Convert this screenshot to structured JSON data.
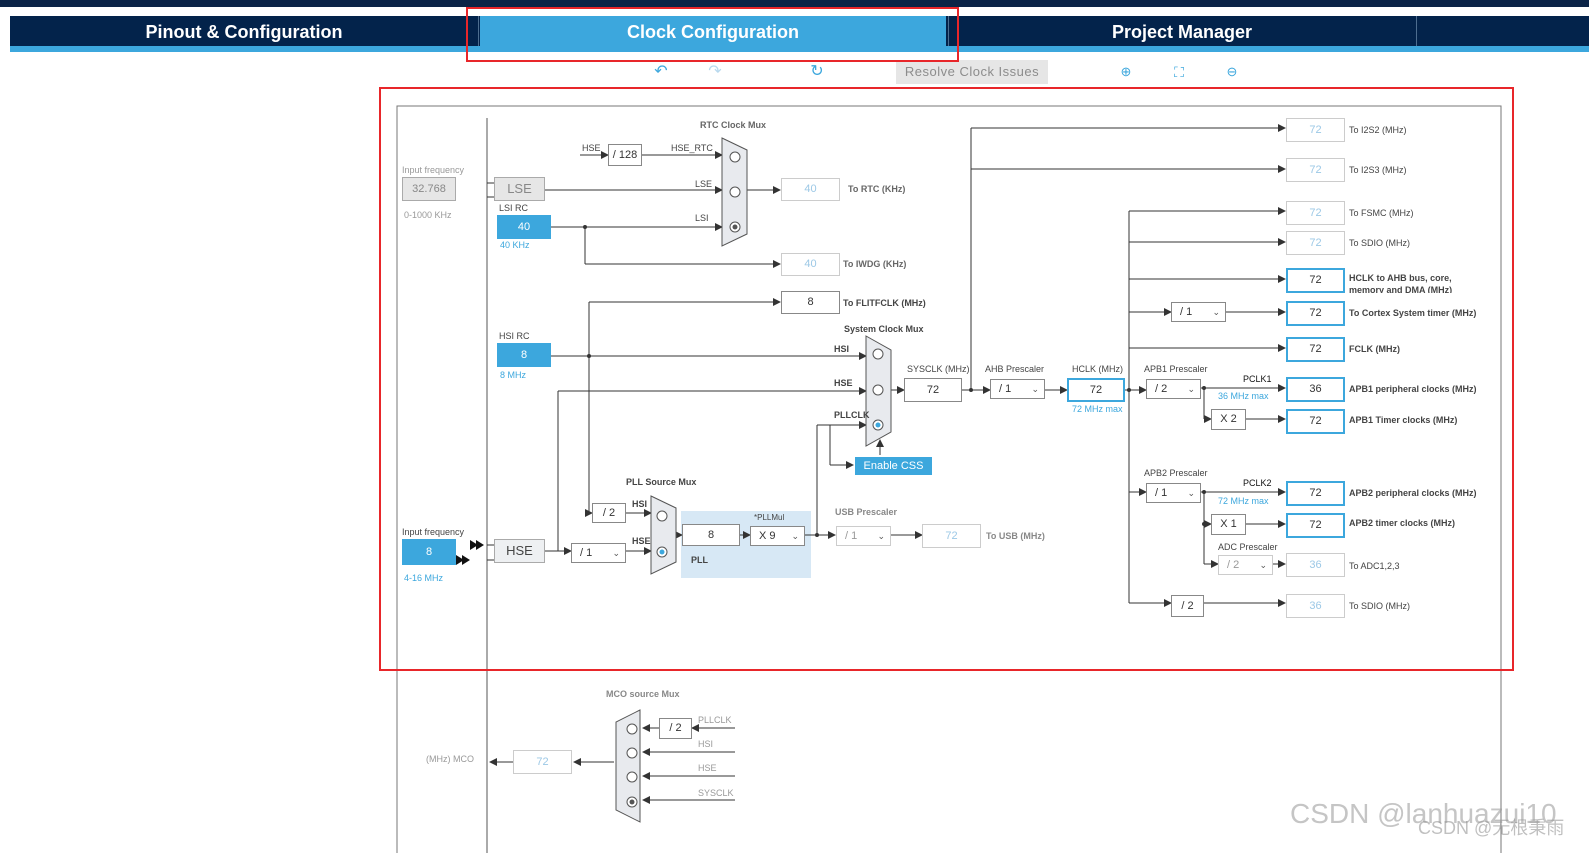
{
  "tabs": {
    "pinout": "Pinout & Configuration",
    "clock": "Clock Configuration",
    "project": "Project Manager"
  },
  "toolbar": {
    "resolve": "Resolve Clock Issues",
    "undo_icon": "undo-icon",
    "redo_icon": "redo-icon",
    "reset_icon": "reset-icon",
    "zoom_in_icon": "zoom-in-icon",
    "fit_icon": "fit-icon",
    "zoom_out_icon": "zoom-out-icon"
  },
  "colors": {
    "accent": "#3ca7dd",
    "navy": "#03234b",
    "highlight": "#e8262a"
  },
  "diagram": {
    "input_freq_label": "Input frequency",
    "lse_input": "32.768",
    "lse_range": "0-1000 KHz",
    "lse": "LSE",
    "lsi_rc": "LSI RC",
    "lsi_value": "40",
    "lsi_unit": "40 KHz",
    "hsi_rc": "HSI RC",
    "hsi_value": "8",
    "hsi_unit": "8 MHz",
    "hse_input_label": "Input frequency",
    "hse_input": "8",
    "hse_range": "4-16 MHz",
    "hse": "HSE",
    "rtc_mux": "RTC Clock Mux",
    "rtc_hse": "HSE",
    "rtc_div": "/ 128",
    "rtc_hse_rtc": "HSE_RTC",
    "rtc_lse": "LSE",
    "rtc_lsi": "LSI",
    "to_rtc_val": "40",
    "to_rtc": "To RTC (KHz)",
    "to_iwdg_val": "40",
    "to_iwdg": "To IWDG (KHz)",
    "flit_val": "8",
    "flit": "To FLITFCLK (MHz)",
    "sys_mux": "System Clock Mux",
    "sys_hsi": "HSI",
    "sys_hse": "HSE",
    "sys_pllclk": "PLLCLK",
    "enable_css": "Enable CSS",
    "sysclk_label": "SYSCLK (MHz)",
    "sysclk": "72",
    "ahb_label": "AHB Prescaler",
    "ahb": "/ 1",
    "hclk_label": "HCLK (MHz)",
    "hclk": "72",
    "hclk_max": "72 MHz max",
    "apb1_label": "APB1 Prescaler",
    "apb1": "/ 2",
    "pclk1": "PCLK1",
    "pclk1_max": "36 MHz max",
    "apb1_x": "X 2",
    "apb2_label": "APB2 Prescaler",
    "apb2": "/ 1",
    "pclk2": "PCLK2",
    "pclk2_max": "72 MHz max",
    "apb2_x": "X 1",
    "adc_label": "ADC Prescaler",
    "adc": "/ 2",
    "cortex_div": "/ 1",
    "sdio_div": "/ 2",
    "pll_src_mux": "PLL Source Mux",
    "pll_hsi_div": "/ 2",
    "pll_hsi": "HSI",
    "pll_hse": "HSE",
    "hse_pre": "/ 1",
    "pll_in": "8",
    "pllmul_label": "*PLLMul",
    "pllmul": "X 9",
    "pll_label": "PLL",
    "usb_label": "USB Prescaler",
    "usb": "/ 1",
    "usb_val": "72",
    "usb_out": "To USB (MHz)",
    "outputs": [
      {
        "val": "72",
        "label": "To I2S2 (MHz)"
      },
      {
        "val": "72",
        "label": "To I2S3 (MHz)"
      },
      {
        "val": "72",
        "label": "To FSMC (MHz)"
      },
      {
        "val": "72",
        "label": "To SDIO (MHz)"
      },
      {
        "val": "72",
        "label": "HCLK to AHB bus, core,"
      },
      {
        "val": "72",
        "label": "To Cortex System timer (MHz)"
      },
      {
        "val": "72",
        "label": "FCLK (MHz)"
      },
      {
        "val": "36",
        "label": "APB1 peripheral clocks (MHz)"
      },
      {
        "val": "72",
        "label": "APB1 Timer clocks (MHz)"
      },
      {
        "val": "72",
        "label": "APB2 peripheral clocks (MHz)"
      },
      {
        "val": "72",
        "label": "APB2 timer clocks (MHz)"
      },
      {
        "val": "36",
        "label": "To ADC1,2,3"
      },
      {
        "val": "36",
        "label": "To SDIO (MHz)"
      }
    ],
    "hclk_bus_line2": "memory and DMA (MHz)",
    "mco_mux": "MCO source Mux",
    "mco_label": "(MHz) MCO",
    "mco_val": "72",
    "mco_div": "/ 2",
    "mco_pllclk": "PLLCLK",
    "mco_hsi": "HSI",
    "mco_hse": "HSE",
    "mco_sysclk": "SYSCLK"
  },
  "watermark": {
    "main": "CSDN @lanhuazui10",
    "sub": "CSDN @无根秉雨"
  }
}
